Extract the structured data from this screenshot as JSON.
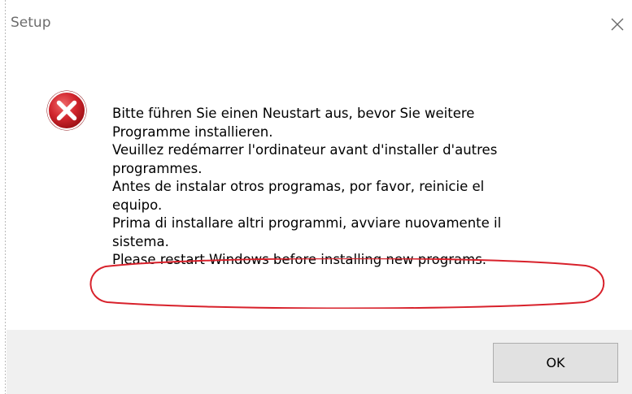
{
  "window": {
    "title": "Setup"
  },
  "icons": {
    "close": "close-icon",
    "error": "error-icon"
  },
  "message": {
    "lines": [
      "Bitte führen Sie einen Neustart aus, bevor Sie weitere",
      "Programme installieren.",
      "Veuillez redémarrer l'ordinateur avant d'installer d'autres",
      "programmes.",
      "Antes de instalar otros programas, por favor, reinicie el",
      "equipo.",
      "Prima di installare altri programmi, avviare nuovamente il",
      "sistema.",
      "Please restart Windows before installing new programs."
    ]
  },
  "buttons": {
    "ok": "OK"
  },
  "colors": {
    "annotation": "#d8212b",
    "error_red": "#c6262e",
    "footer_bg": "#f0f0f0"
  }
}
